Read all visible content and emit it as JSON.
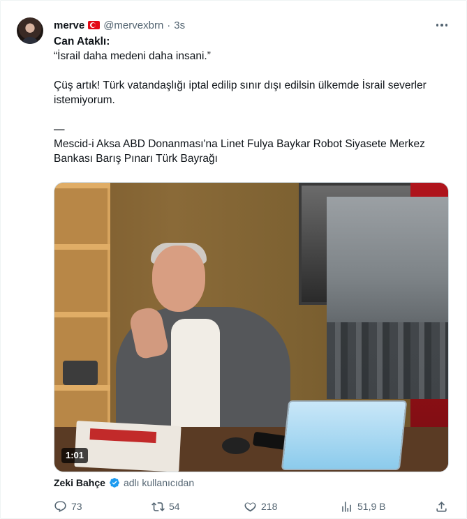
{
  "author": {
    "name": "merve",
    "flag": "turkey-flag",
    "handle": "@mervexbrn",
    "separator": "·",
    "time": "3s"
  },
  "tweet": {
    "line1": "Can Ataklı:",
    "line2": "“İsrail daha medeni daha insani.”",
    "line3": "Çüş artık! Türk vatandaşlığı iptal edilip sınır dışı edilsin ülkemde İsrail severler istemiyorum.",
    "line4": "—",
    "line5": "Mescid-i Aksa ABD Donanması'na Linet Fulya Baykar Robot Siyasete Merkez Bankası Barış Pınarı Türk Bayrağı"
  },
  "media": {
    "duration": "1:01"
  },
  "attribution": {
    "name": "Zeki Bahçe",
    "suffix": "adlı kullanıcıdan"
  },
  "actions": {
    "replies": "73",
    "retweets": "54",
    "likes": "218",
    "views": "51,9 B"
  },
  "colors": {
    "text": "#0f1419",
    "secondary": "#536471",
    "verified": "#1d9bf0",
    "border": "#cfd9de"
  }
}
